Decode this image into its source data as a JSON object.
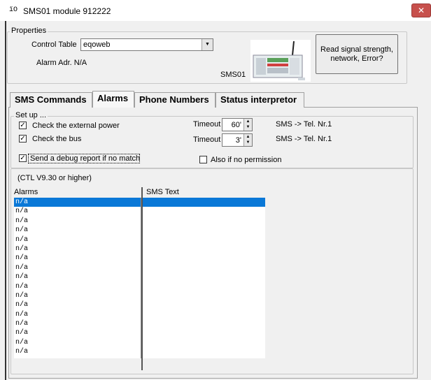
{
  "window": {
    "title_icon": "ïO",
    "title": "SMS01 module 912222",
    "close_label": "✕"
  },
  "properties": {
    "legend": "Properties",
    "control_table_label": "Control Table",
    "control_table_value": "eqoweb",
    "alarm_addr": "Alarm Adr. N/A",
    "device_caption": "SMS01",
    "read_button_label": "Read signal strength, network, Error?"
  },
  "tabs": [
    {
      "label": "SMS Commands"
    },
    {
      "label": "Alarms"
    },
    {
      "label": "Phone Numbers"
    },
    {
      "label": "Status interpretor"
    }
  ],
  "setup": {
    "legend": "Set up ...",
    "external_power_label": "Check the external power",
    "bus_label": "Check the bus",
    "timeout_label": "Timeout",
    "timeout1_value": "60'",
    "timeout2_value": "3'",
    "sms_tel1": "SMS -> Tel. Nr.1",
    "sms_tel2": "SMS -> Tel. Nr.1",
    "debug_label": "Send a debug report if no match",
    "permission_label": "Also if no permission"
  },
  "list": {
    "version_note": "(CTL V9.30 or higher)",
    "col_alarms": "Alarms",
    "col_sms": "SMS Text",
    "alarms": [
      "n/a",
      "n/a",
      "n/a",
      "n/a",
      "n/a",
      "n/a",
      "n/a",
      "n/a",
      "n/a",
      "n/a",
      "n/a",
      "n/a",
      "n/a",
      "n/a",
      "n/a",
      "n/a",
      "n/a"
    ],
    "selected_index": 0
  },
  "colors": {
    "selection": "#0a78d7",
    "close_button": "#c7504c"
  }
}
